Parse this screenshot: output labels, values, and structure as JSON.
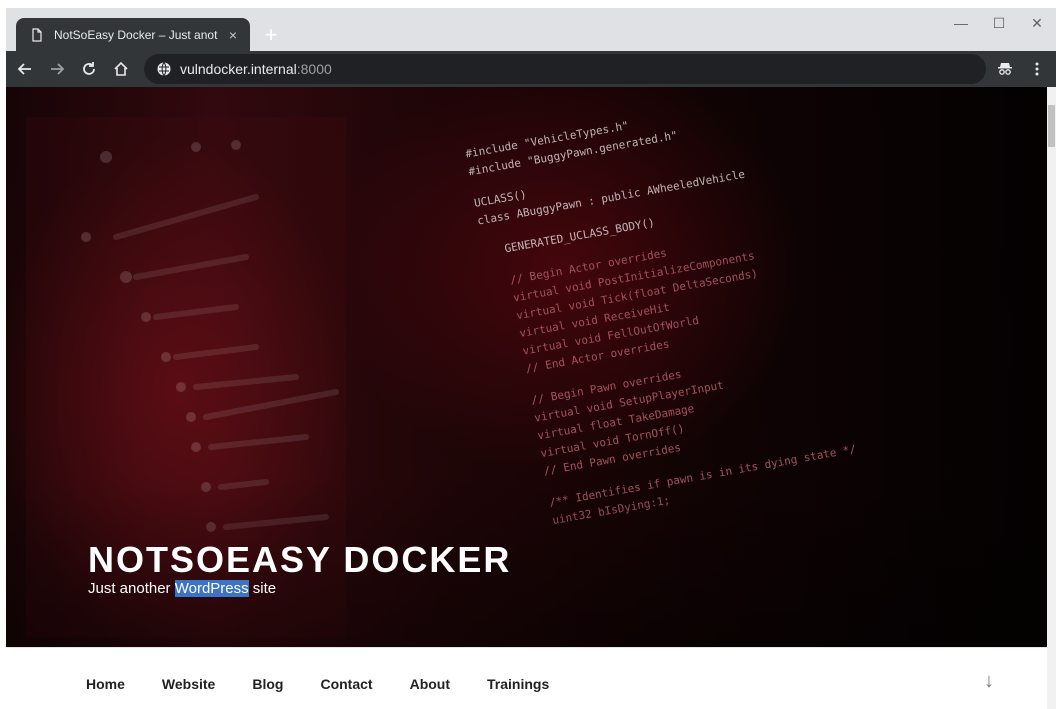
{
  "browser": {
    "tab": {
      "title": "NotSoEasy Docker – Just another",
      "close": "×"
    },
    "new_tab": "+",
    "window_controls": {
      "minimize": "—",
      "maximize": "☐",
      "close": "✕"
    },
    "url": {
      "host": "vulndocker.internal",
      "port": ":8000"
    },
    "icons": [
      "back-icon",
      "forward-icon",
      "reload-icon",
      "home-icon",
      "site-info-icon",
      "incognito-icon",
      "menu-icon"
    ]
  },
  "site": {
    "title": "NOTSOEASY DOCKER",
    "tagline_prefix": "Just another ",
    "tagline_highlight": "WordPress",
    "tagline_suffix": " site"
  },
  "menu": {
    "items": [
      "Home",
      "Website",
      "Blog",
      "Contact",
      "About",
      "Trainings"
    ],
    "scroll_down": "↓"
  },
  "hero_code": [
    "#include \"VehicleTypes.h\"",
    "#include \"BuggyPawn.generated.h\"",
    "UCLASS()",
    "class ABuggyPawn : public AWheeledVehicle",
    "GENERATED_UCLASS_BODY()",
    "// Begin Actor overrides",
    "virtual void PostInitializeComponents",
    "virtual void Tick(float DeltaSeconds)",
    "virtual void ReceiveHit",
    "virtual void FellOutOfWorld",
    "// End Actor overrides",
    "// Begin Pawn overrides",
    "virtual void SetupPlayerInput",
    "virtual float TakeDamage",
    "virtual void TornOff()",
    "// End Pawn overrides",
    "/** Identifies if pawn is in its dying state */",
    "uint32 bIsDying:1;"
  ],
  "colors": {
    "chrome_dark": "#323639",
    "omnibox": "#202124",
    "highlight": "#3b73c7"
  }
}
